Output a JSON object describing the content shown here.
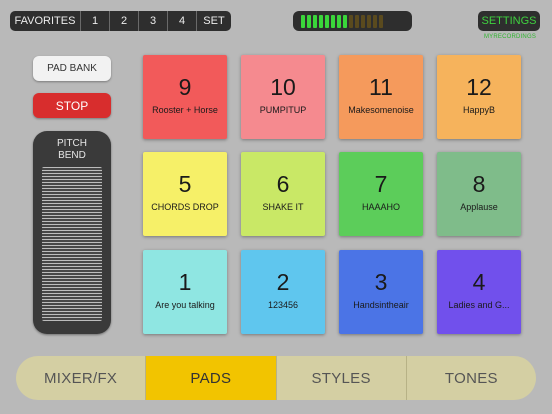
{
  "favorites_bar": {
    "label": "FAVORITES",
    "slots": [
      "1",
      "2",
      "3",
      "4"
    ],
    "set_label": "SET"
  },
  "meter": {
    "segments_total": 14,
    "segments_active": 8,
    "active_color": "#3ad63a",
    "inactive_color": "#5a4a1e"
  },
  "settings": {
    "label": "SETTINGS",
    "sublabel": "MYRECORDINGS"
  },
  "left_controls": {
    "pad_bank_label": "PAD BANK",
    "stop_label": "STOP",
    "pitch_bend_label_line1": "PITCH",
    "pitch_bend_label_line2": "BEND"
  },
  "pads": [
    {
      "number": "9",
      "name": "Rooster + Horse",
      "color": "#f25a5a"
    },
    {
      "number": "10",
      "name": "PUMPITUP",
      "color": "#f58a8f"
    },
    {
      "number": "11",
      "name": "Makesomenoise",
      "color": "#f59a5c"
    },
    {
      "number": "12",
      "name": "HappyB",
      "color": "#f6b35c"
    },
    {
      "number": "5",
      "name": "CHORDS DROP",
      "color": "#f6f068"
    },
    {
      "number": "6",
      "name": "SHAKE IT",
      "color": "#c9e866"
    },
    {
      "number": "7",
      "name": "HAAAHO",
      "color": "#5ccd5a"
    },
    {
      "number": "8",
      "name": "Applause",
      "color": "#7fbc8a"
    },
    {
      "number": "1",
      "name": "Are you talking",
      "color": "#8fe6e2"
    },
    {
      "number": "2",
      "name": "123456",
      "color": "#5fc6ee"
    },
    {
      "number": "3",
      "name": "Handsintheair",
      "color": "#4b74e6"
    },
    {
      "number": "4",
      "name": "Ladies and G...",
      "color": "#7150ec"
    }
  ],
  "tabs": [
    {
      "label": "MIXER/FX",
      "active": false
    },
    {
      "label": "PADS",
      "active": true
    },
    {
      "label": "STYLES",
      "active": false
    },
    {
      "label": "TONES",
      "active": false
    }
  ]
}
